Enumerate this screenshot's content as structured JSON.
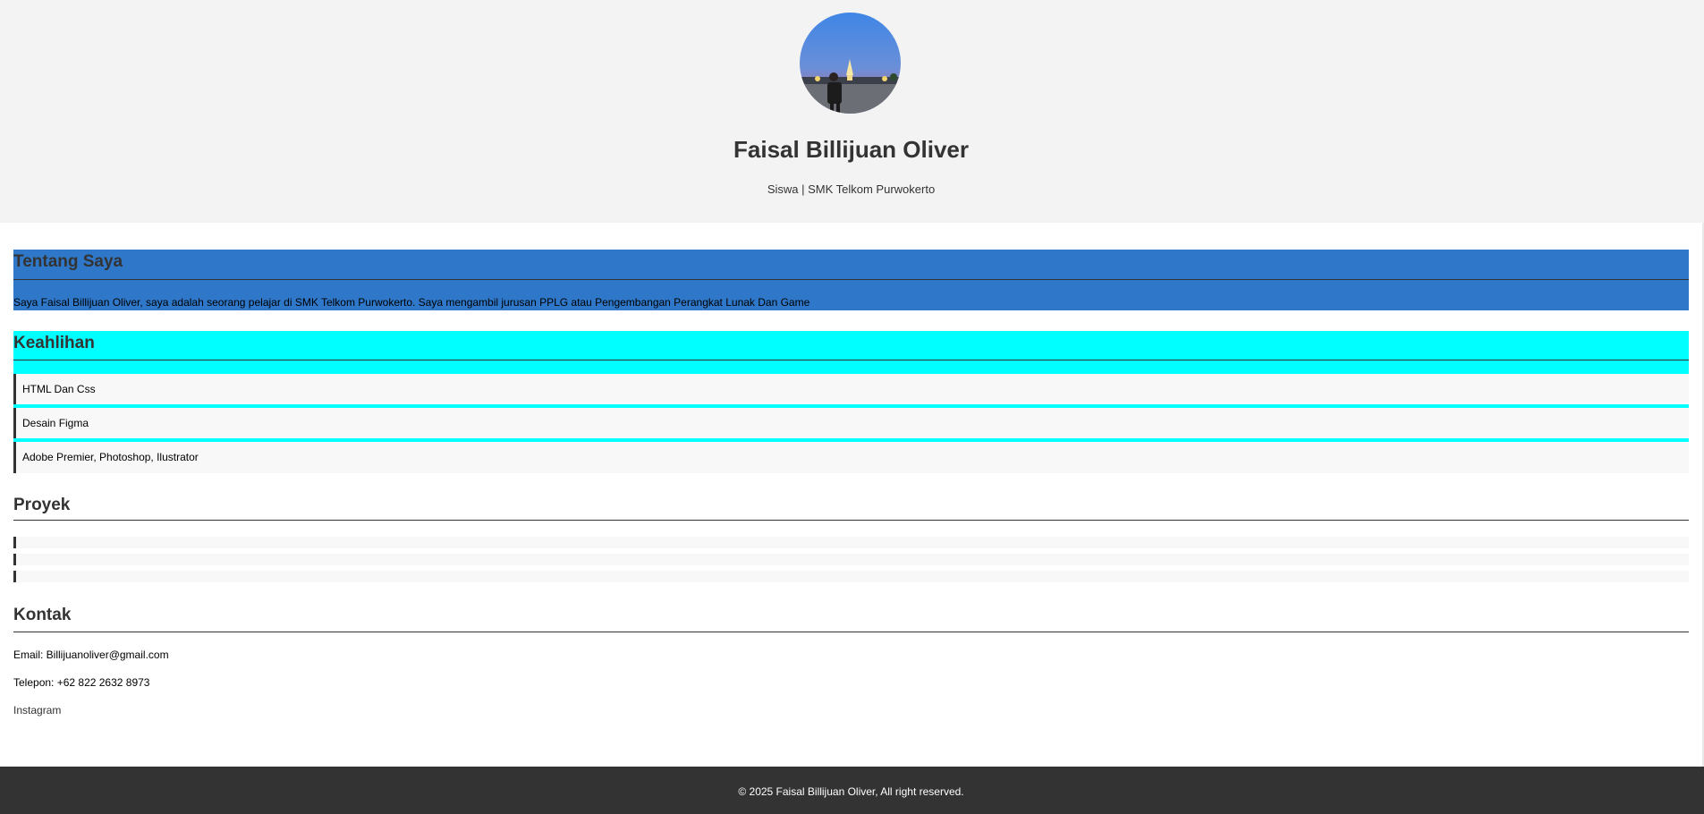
{
  "header": {
    "name": "Faisal Billijuan Oliver",
    "subtitle": "Siswa | SMK Telkom Purwokerto",
    "avatar_icon": "profile-photo"
  },
  "about": {
    "title": "Tentang Saya",
    "text": "Saya Faisal Billijuan Oliver, saya adalah seorang pelajar di SMK Telkom Purwokerto. Saya mengambil jurusan PPLG atau Pengembangan Perangkat Lunak Dan Game",
    "background": "#2f78c9"
  },
  "skills": {
    "title": "Keahlihan",
    "accent": "#00ffff",
    "items": [
      "HTML Dan Css",
      "Desain Figma",
      "Adobe Premier, Photoshop, Ilustrator"
    ]
  },
  "projects": {
    "title": "Proyek",
    "items": [
      "",
      "",
      ""
    ]
  },
  "contact": {
    "title": "Kontak",
    "email": "Email: Billijuanoliver@gmail.com",
    "phone": "Telepon: +62 822 2632 8973",
    "instagram_label": "Instagram"
  },
  "footer": {
    "text": "© 2025 Faisal Billijuan Oliver, All right reserved.",
    "background": "#333333"
  }
}
